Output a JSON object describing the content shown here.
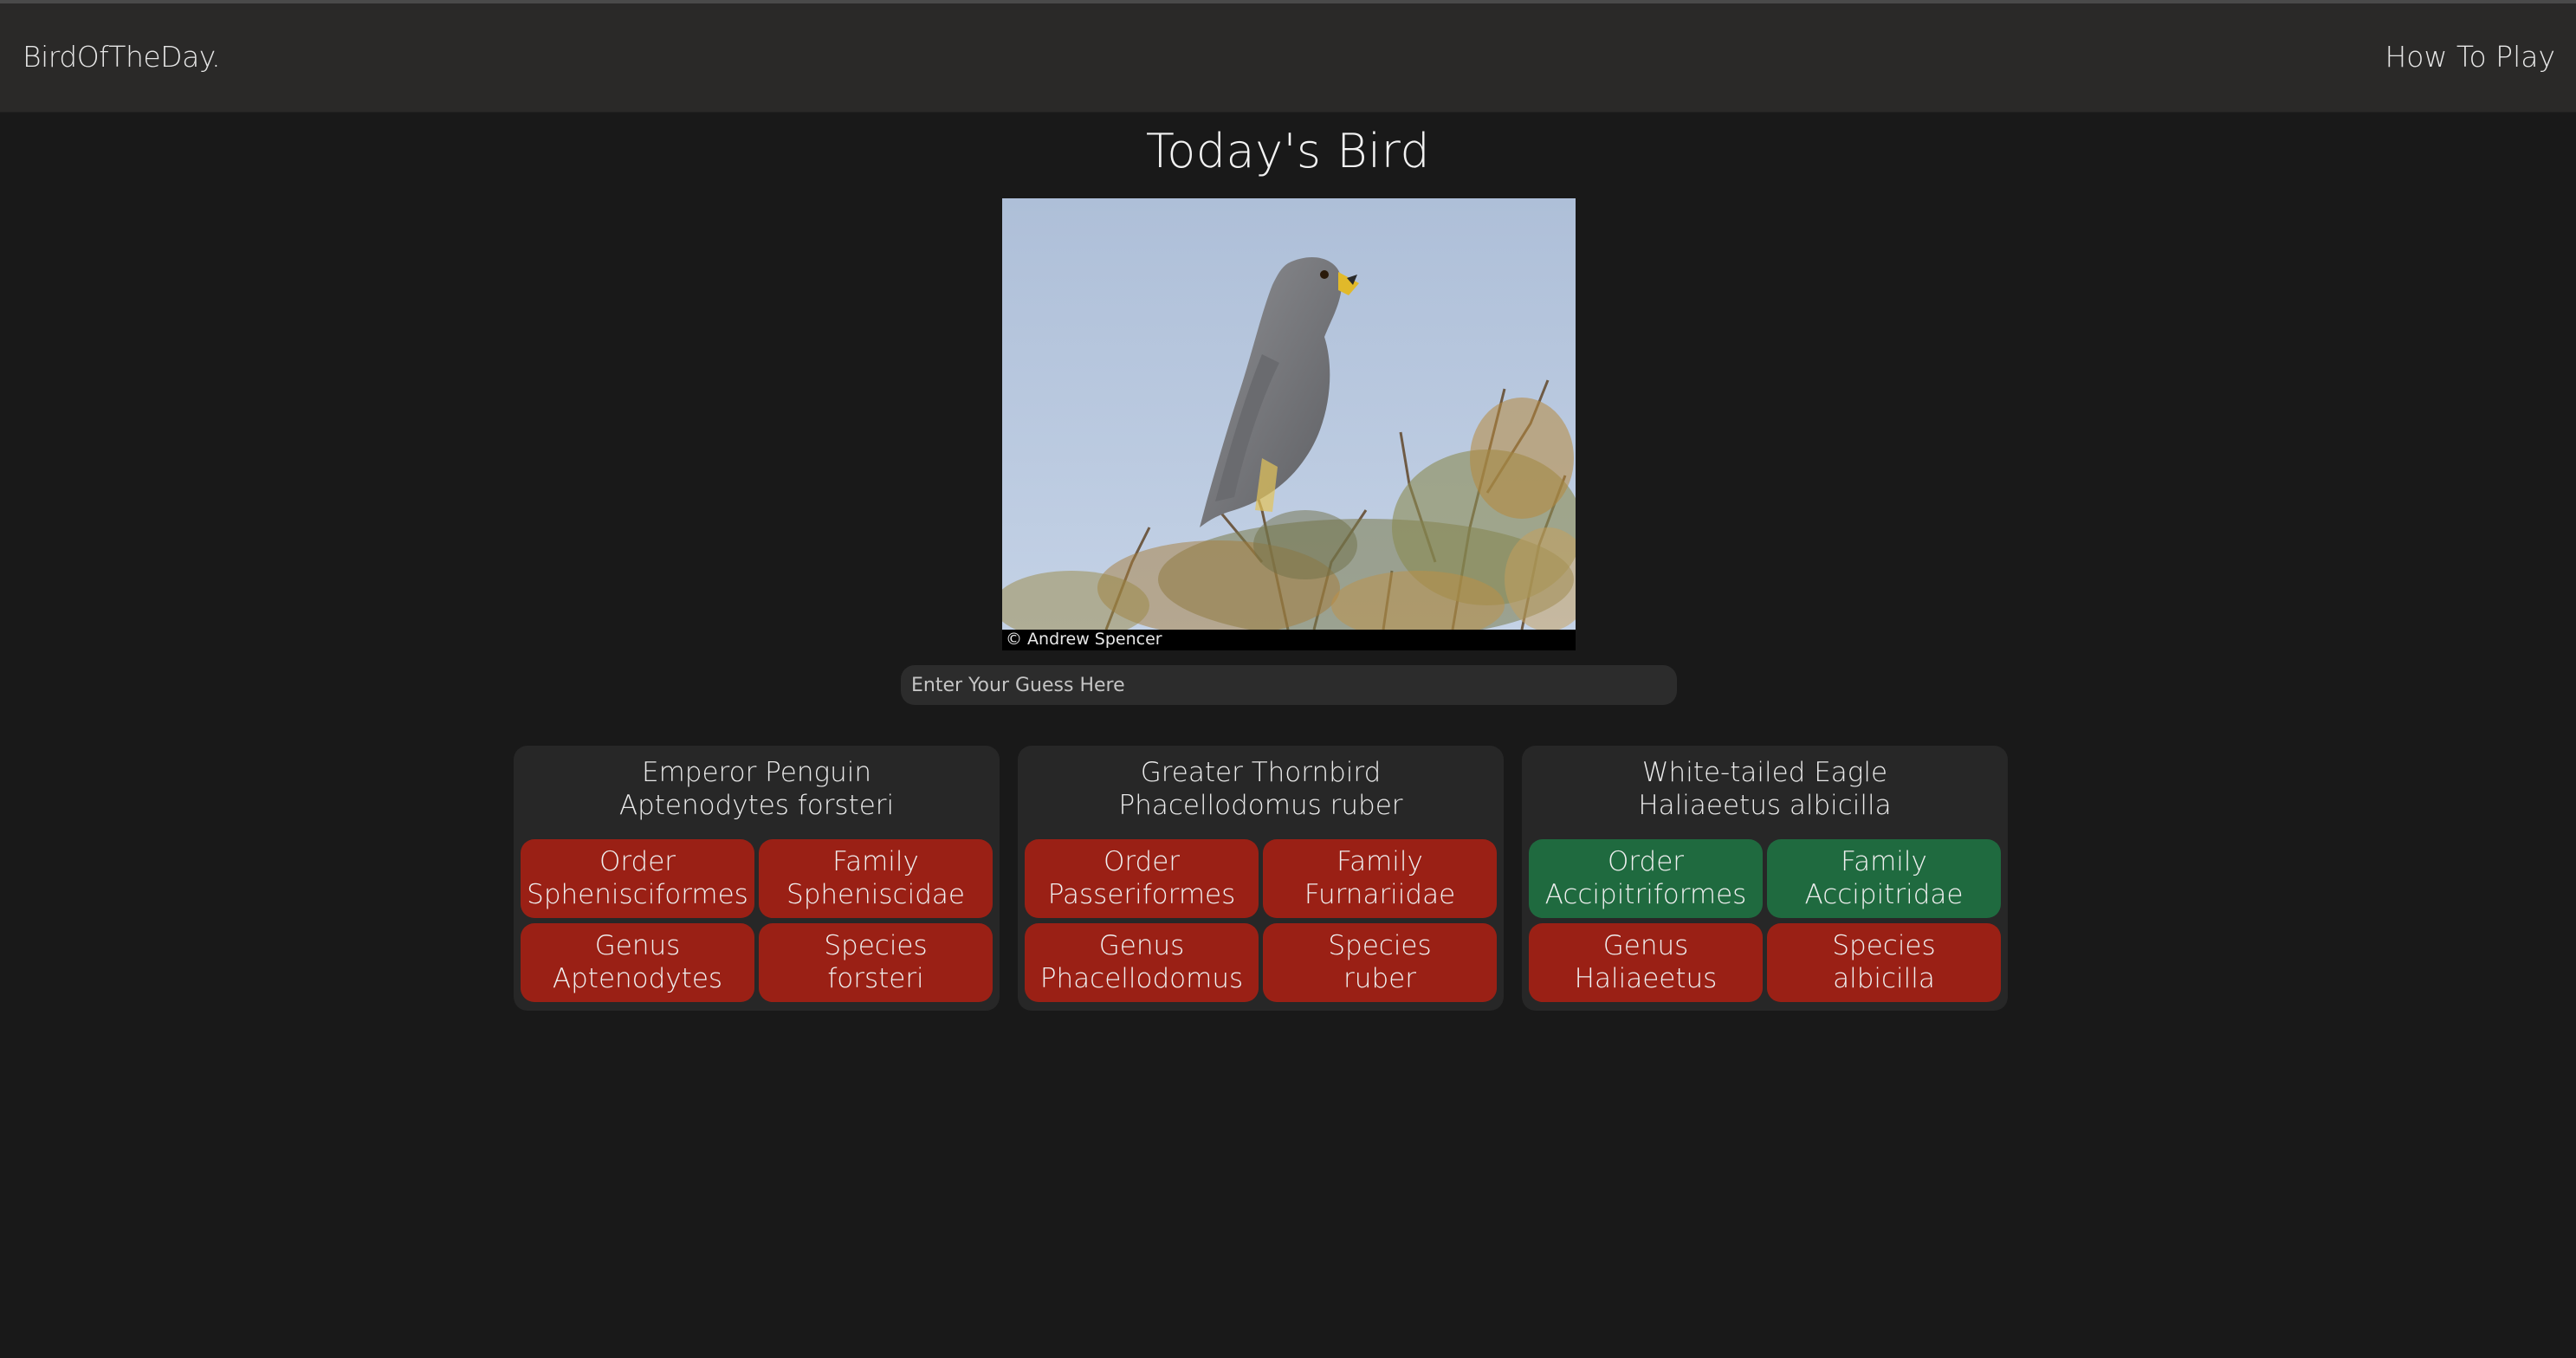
{
  "nav": {
    "brand": "BirdOfTheDay.",
    "how_to_play": "How To Play"
  },
  "page": {
    "title": "Today's Bird"
  },
  "photo": {
    "credit": "© Andrew Spencer",
    "icon": "bird-photo"
  },
  "guess": {
    "placeholder": "Enter Your Guess Here",
    "value": ""
  },
  "colors": {
    "correct": "#1f6a3f",
    "wrong": "#9a2015",
    "background": "#191919",
    "navbar": "#2a2928",
    "card": "#272727"
  },
  "guesses": [
    {
      "common_name": "Emperor Penguin",
      "scientific_name": "Aptenodytes forsteri",
      "ranks": [
        {
          "label": "Order",
          "value": "Sphenisciformes",
          "status": "wrong"
        },
        {
          "label": "Family",
          "value": "Spheniscidae",
          "status": "wrong"
        },
        {
          "label": "Genus",
          "value": "Aptenodytes",
          "status": "wrong"
        },
        {
          "label": "Species",
          "value": "forsteri",
          "status": "wrong"
        }
      ]
    },
    {
      "common_name": "Greater Thornbird",
      "scientific_name": "Phacellodomus ruber",
      "ranks": [
        {
          "label": "Order",
          "value": "Passeriformes",
          "status": "wrong"
        },
        {
          "label": "Family",
          "value": "Furnariidae",
          "status": "wrong"
        },
        {
          "label": "Genus",
          "value": "Phacellodomus",
          "status": "wrong"
        },
        {
          "label": "Species",
          "value": "ruber",
          "status": "wrong"
        }
      ]
    },
    {
      "common_name": "White-tailed Eagle",
      "scientific_name": "Haliaeetus albicilla",
      "ranks": [
        {
          "label": "Order",
          "value": "Accipitriformes",
          "status": "correct"
        },
        {
          "label": "Family",
          "value": "Accipitridae",
          "status": "correct"
        },
        {
          "label": "Genus",
          "value": "Haliaeetus",
          "status": "wrong"
        },
        {
          "label": "Species",
          "value": "albicilla",
          "status": "wrong"
        }
      ]
    }
  ]
}
